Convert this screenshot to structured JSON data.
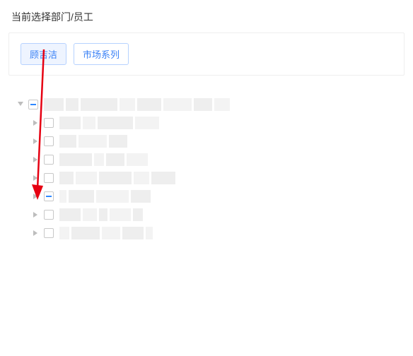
{
  "section_title": "当前选择部门/员工",
  "tags": [
    {
      "label": "顾吉洁"
    },
    {
      "label": "市场系列"
    }
  ],
  "tree": {
    "root": {
      "expanded": true,
      "indeterminate": true
    },
    "children_count": 7
  },
  "annotation": {
    "arrow_color": "#e60012"
  }
}
